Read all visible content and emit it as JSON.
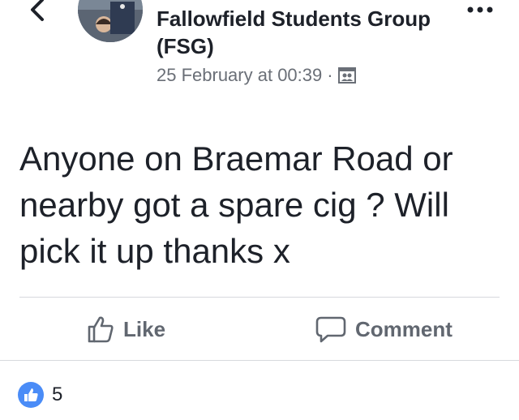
{
  "post": {
    "group_name": "Fallowfield Students Group (FSG)",
    "timestamp": "25 February at 00:39",
    "separator": "·",
    "audience_icon": "group-audience-icon",
    "text": "Anyone on Braemar Road or nearby got a spare cig ? Will pick it up thanks x"
  },
  "actions": {
    "like_label": "Like",
    "comment_label": "Comment"
  },
  "reactions": {
    "like_count": "5"
  },
  "colors": {
    "text": "#1d2129",
    "meta": "#6a6f77",
    "action": "#616770",
    "like_blue": "#4a8cf7",
    "divider": "#d7d9dd"
  }
}
